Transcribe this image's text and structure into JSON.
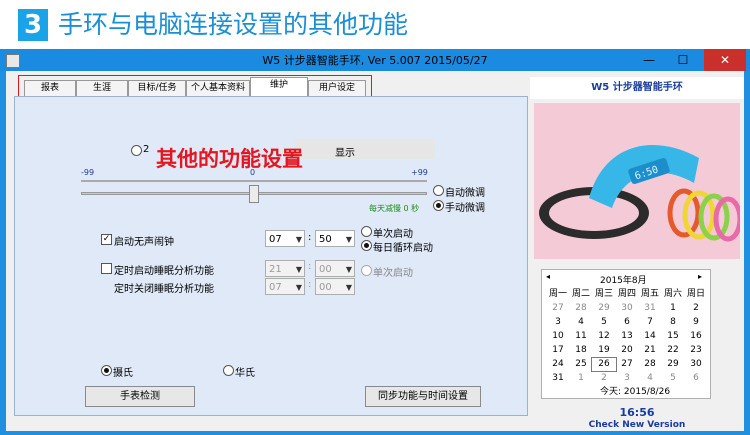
{
  "banner": {
    "number": "3",
    "title": "手环与电脑连接设置的其他功能"
  },
  "window": {
    "title": "W5  计步器智能手环, Ver 5.007  2015/05/27",
    "min": "—",
    "max": "☐",
    "close": "✕"
  },
  "tabs": [
    "报表",
    "生涯",
    "目标/任务",
    "个人基本资料",
    "维护",
    "用户设定"
  ],
  "active_tab": "维护",
  "overlay_text": "其他的功能设置",
  "fine_tune": {
    "radio_partial": "2",
    "hidden_suffix": "显示",
    "slider_min": "-99",
    "slider_mid": "0",
    "slider_max": "+99",
    "slider_value_fraction": 0.5,
    "auto_label": "自动微调",
    "manual_label": "手动微调",
    "note": "每天减慢 0 秒"
  },
  "alarm": {
    "checkbox_label": "启动无声闹钟",
    "checked": true,
    "hour": "07",
    "minute": "50",
    "once_label": "单次启动",
    "daily_label": "每日循环启动"
  },
  "sleep": {
    "start_label": "定时启动睡眠分析功能",
    "stop_label": "定时关闭睡眠分析功能",
    "start_hour": "21",
    "start_minute": "00",
    "stop_hour": "07",
    "stop_minute": "00",
    "once_label": "单次启动"
  },
  "units": {
    "celsius": "摄氏",
    "fahrenheit": "华氏"
  },
  "buttons": {
    "detect": "手表检测",
    "sync": "同步功能与时间设置"
  },
  "right": {
    "product_title": "W5 计步器智能手环",
    "check_version": "Check New Version",
    "clock": "16:56"
  },
  "calendar": {
    "prev": "◂",
    "next": "▸",
    "month": "2015年8月",
    "weekdays": [
      "周一",
      "周二",
      "周三",
      "周四",
      "周五",
      "周六",
      "周日"
    ],
    "rows": [
      [
        "27",
        "28",
        "29",
        "30",
        "31",
        "1",
        "2"
      ],
      [
        "3",
        "4",
        "5",
        "6",
        "7",
        "8",
        "9"
      ],
      [
        "10",
        "11",
        "12",
        "13",
        "14",
        "15",
        "16"
      ],
      [
        "17",
        "18",
        "19",
        "20",
        "21",
        "22",
        "23"
      ],
      [
        "24",
        "25",
        "26",
        "27",
        "28",
        "29",
        "30"
      ],
      [
        "31",
        "1",
        "2",
        "3",
        "4",
        "5",
        "6"
      ]
    ],
    "today_text": "今天: 2015/8/26"
  }
}
